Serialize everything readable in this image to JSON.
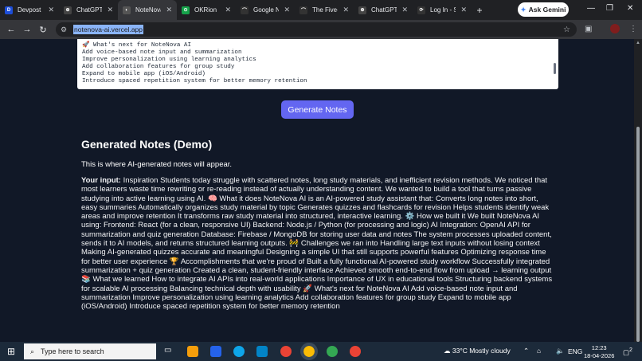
{
  "browser": {
    "tabs": [
      {
        "title": "Devpost",
        "fav": "D",
        "color": "#1d4ed8"
      },
      {
        "title": "ChatGPT",
        "fav": "⊕",
        "color": "#444"
      },
      {
        "title": "NoteNova",
        "fav": "◐",
        "color": "#555",
        "active": true
      },
      {
        "title": "OKRion",
        "fav": "⊙",
        "color": "#16a34a"
      },
      {
        "title": "Google N",
        "fav": "⌒",
        "color": "#333"
      },
      {
        "title": "The Five-F",
        "fav": "⌒",
        "color": "#333"
      },
      {
        "title": "ChatGPT",
        "fav": "⊕",
        "color": "#444"
      },
      {
        "title": "Log In - S",
        "fav": "⟳",
        "color": "#333"
      }
    ],
    "ask_gemini": "Ask Gemini",
    "url": "notenova-ai.vercel.app"
  },
  "input": {
    "lines": [
      "🚀 What's next for NoteNova AI",
      "Add voice-based note input and summarization",
      "Improve personalization using learning analytics",
      "Add collaboration features for group study",
      "Expand to mobile app (iOS/Android)",
      "Introduce spaced repetition system for better memory retention"
    ]
  },
  "actions": {
    "generate_label": "Generate Notes"
  },
  "output": {
    "heading": "Generated Notes (Demo)",
    "placeholder": "This is where AI-generated notes will appear.",
    "input_label": "Your input:",
    "body": "Inspiration Students today struggle with scattered notes, long study materials, and inefficient revision methods. We noticed that most learners waste time rewriting or re-reading instead of actually understanding content. We wanted to build a tool that turns passive studying into active learning using AI. 🧠 What it does NoteNova AI is an AI-powered study assistant that: Converts long notes into short, easy summaries Automatically organizes study material by topic Generates quizzes and flashcards for revision Helps students identify weak areas and improve retention It transforms raw study material into structured, interactive learning. ⚙️ How we built it We built NoteNova AI using: Frontend: React (for a clean, responsive UI) Backend: Node.js / Python (for processing and logic) AI Integration: OpenAI API for summarization and quiz generation Database: Firebase / MongoDB for storing user data and notes The system processes uploaded content, sends it to AI models, and returns structured learning outputs. 🚧 Challenges we ran into Handling large text inputs without losing context Making AI-generated quizzes accurate and meaningful Designing a simple UI that still supports powerful features Optimizing response time for better user experience 🏆 Accomplishments that we're proud of Built a fully functional AI-powered study workflow Successfully integrated summarization + quiz generation Created a clean, student-friendly interface Achieved smooth end-to-end flow from upload → learning output 📚 What we learned How to integrate AI APIs into real-world applications Importance of UX in educational tools Structuring backend systems for scalable AI processing Balancing technical depth with usability 🚀 What's next for NoteNova AI Add voice-based note input and summarization Improve personalization using learning analytics Add collaboration features for group study Expand to mobile app (iOS/Android) Introduce spaced repetition system for better memory retention"
  },
  "taskbar": {
    "search_placeholder": "Type here to search",
    "weather": "33°C  Mostly cloudy",
    "lang": "ENG",
    "time": "12:23",
    "date": "18-04-2026",
    "notifications": "2"
  }
}
